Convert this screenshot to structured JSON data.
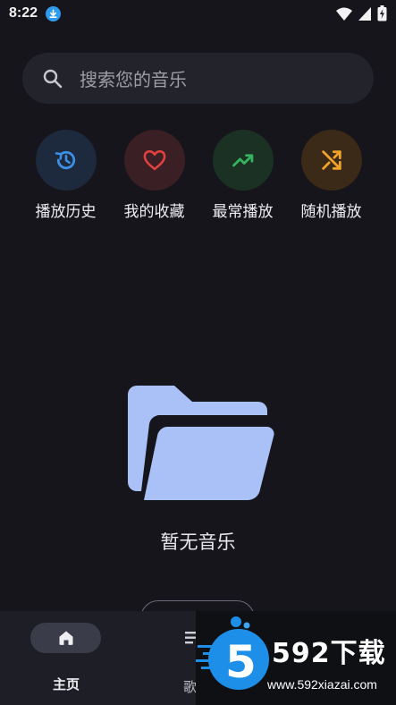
{
  "status_bar": {
    "time": "8:22"
  },
  "search": {
    "placeholder": "搜索您的音乐"
  },
  "quick_actions": [
    {
      "label": "播放历史",
      "icon": "history-icon",
      "color": "#3d8fe6",
      "bg": "#1d2a3d"
    },
    {
      "label": "我的收藏",
      "icon": "heart-icon",
      "color": "#e2413f",
      "bg": "#3a1f24"
    },
    {
      "label": "最常播放",
      "icon": "trending-up-icon",
      "color": "#35b35e",
      "bg": "#1a3123"
    },
    {
      "label": "随机播放",
      "icon": "shuffle-icon",
      "color": "#f0a22b",
      "bg": "#3a2a17"
    }
  ],
  "empty_state": {
    "text": "暂无音乐",
    "icon": "folder-open-icon",
    "icon_color": "#a9c1f7"
  },
  "bottom_nav": {
    "home_label": "主页",
    "second_label": "歌"
  },
  "watermark": {
    "brand": "592下载",
    "url": "www.592xiazai.com",
    "logo_char": "5"
  }
}
